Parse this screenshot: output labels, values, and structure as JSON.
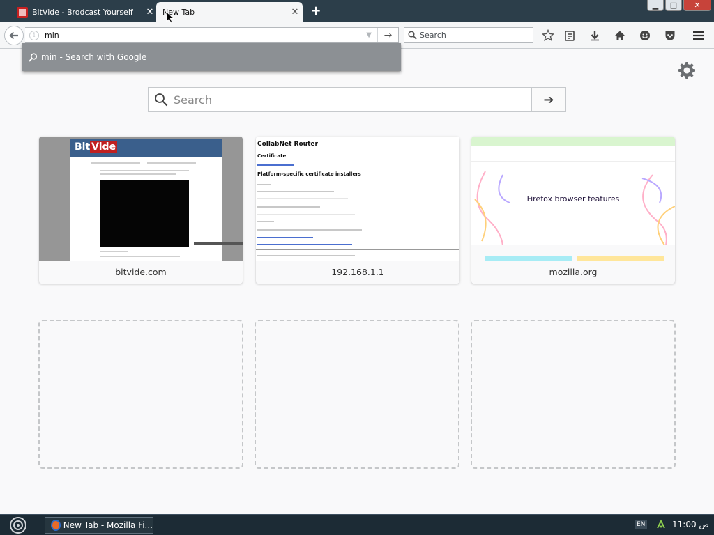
{
  "tabs": [
    {
      "title": "BitVide - Brodcast Yourself",
      "active": false
    },
    {
      "title": "New Tab",
      "active": true
    }
  ],
  "window_controls": {
    "minimize": "▁",
    "maximize": "□",
    "close": "✕"
  },
  "toolbar": {
    "url_value": "min",
    "search_placeholder": "Search"
  },
  "autocomplete": {
    "text": "min - Search with Google"
  },
  "newtab": {
    "search_placeholder": "Search",
    "tiles": [
      {
        "label": "bitvide.com",
        "thumb": "bitvide-screenshot"
      },
      {
        "label": "192.168.1.1",
        "thumb": "collabnet-router-screenshot",
        "thumb_heading": "CollabNet Router",
        "thumb_sub1": "Certificate",
        "thumb_sub2": "Platform-specific certificate installers"
      },
      {
        "label": "mozilla.org",
        "thumb": "mozilla-screenshot",
        "thumb_heading": "Firefox browser features"
      }
    ],
    "empty_slots": 3
  },
  "taskbar": {
    "task_label": "New Tab - Mozilla Fi...",
    "lang": "EN",
    "clock": "11:00 ص"
  },
  "colors": {
    "tabbar": "#2c3e4a",
    "toolbar": "#f5f6f7",
    "autocomplete": "#8c9094",
    "page_bg": "#f9f9fa",
    "taskbar": "#1c2b35",
    "close_button": "#c7433a"
  }
}
